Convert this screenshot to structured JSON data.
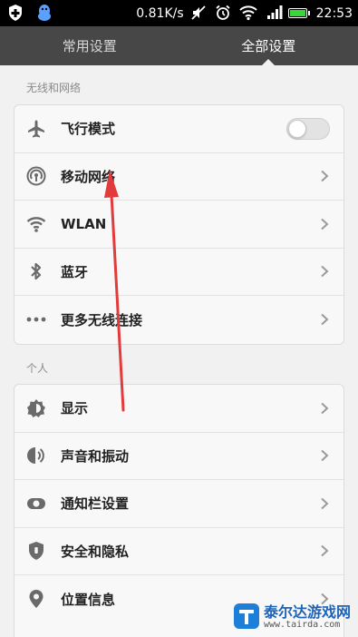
{
  "status_bar": {
    "speed": "0.81K/s",
    "time": "22:53"
  },
  "tabs": [
    {
      "label": "常用设置",
      "active": false
    },
    {
      "label": "全部设置",
      "active": true
    }
  ],
  "sections": [
    {
      "title": "无线和网络",
      "items": [
        {
          "label": "飞行模式",
          "icon": "airplane-icon",
          "control": "toggle",
          "toggle_on": false
        },
        {
          "label": "移动网络",
          "icon": "cellular-icon",
          "control": "chevron"
        },
        {
          "label": "WLAN",
          "icon": "wifi-icon",
          "control": "chevron"
        },
        {
          "label": "蓝牙",
          "icon": "bluetooth-icon",
          "control": "chevron"
        },
        {
          "label": "更多无线连接",
          "icon": "more-dots-icon",
          "control": "chevron"
        }
      ]
    },
    {
      "title": "个人",
      "items": [
        {
          "label": "显示",
          "icon": "brightness-icon",
          "control": "chevron"
        },
        {
          "label": "声音和振动",
          "icon": "sound-icon",
          "control": "chevron"
        },
        {
          "label": "通知栏设置",
          "icon": "notification-toggle-icon",
          "control": "chevron"
        },
        {
          "label": "安全和隐私",
          "icon": "shield-icon",
          "control": "chevron"
        },
        {
          "label": "位置信息",
          "icon": "location-pin-icon",
          "control": "chevron"
        }
      ]
    }
  ],
  "watermark": {
    "name": "泰尔达游戏网",
    "url": "www.tairda.com"
  },
  "colors": {
    "tab_bar": "#474747",
    "annotation_arrow": "#e23b3b",
    "battery": "#38d638"
  }
}
